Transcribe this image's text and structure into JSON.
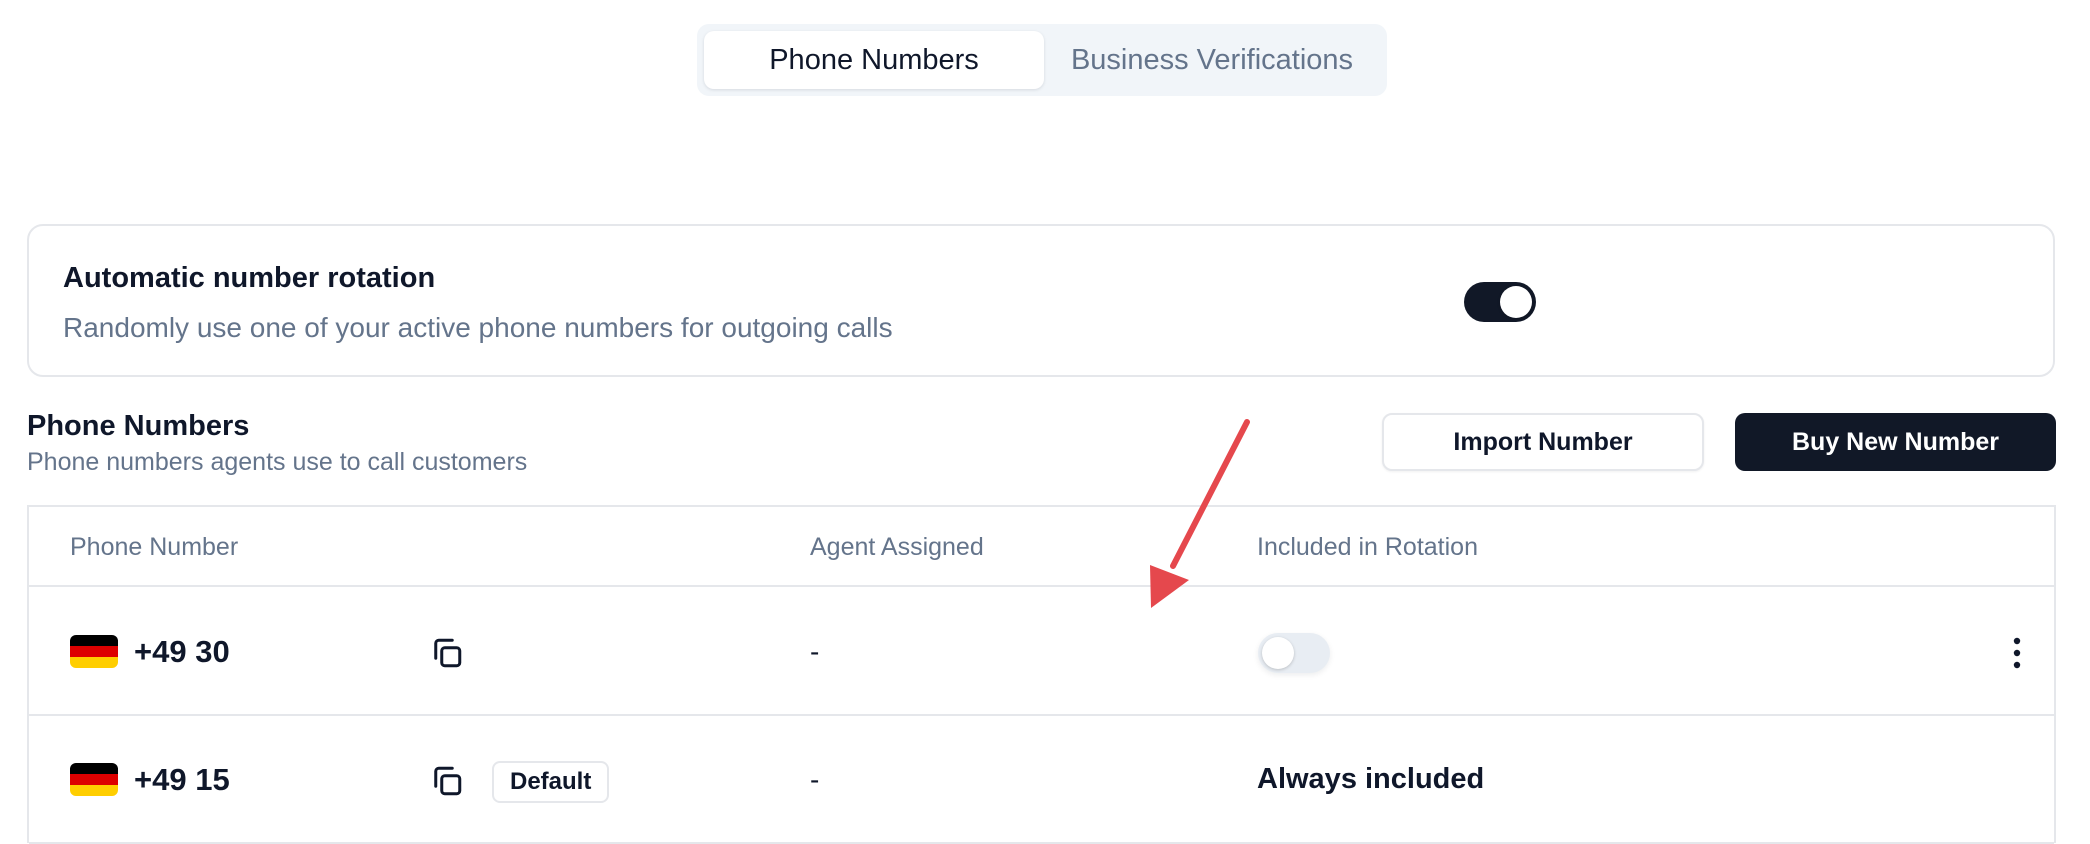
{
  "tabs": [
    {
      "label": "Phone Numbers",
      "active": true
    },
    {
      "label": "Business Verifications",
      "active": false
    }
  ],
  "rotation": {
    "title": "Automatic number rotation",
    "description": "Randomly use one of your active phone numbers for outgoing calls",
    "enabled": true
  },
  "section": {
    "title": "Phone Numbers",
    "subtitle": "Phone numbers agents use to call customers",
    "import_label": "Import Number",
    "buy_label": "Buy New Number"
  },
  "table": {
    "columns": [
      "Phone Number",
      "Agent Assigned",
      "Included in Rotation"
    ],
    "rows": [
      {
        "flag": "germany-flag-icon",
        "number": "+49 30",
        "badge": "",
        "agent": "-",
        "rotation_enabled": false,
        "rotation_text": ""
      },
      {
        "flag": "germany-flag-icon",
        "number": "+49 15",
        "badge": "Default",
        "agent": "-",
        "rotation_enabled": null,
        "rotation_text": "Always included"
      }
    ]
  },
  "colors": {
    "dark": "#111827",
    "muted": "#64748b",
    "border": "#e5e7eb",
    "annotation_arrow": "#e5484d",
    "flag_black": "#000000",
    "flag_red": "#dd0000",
    "flag_gold": "#ffce00"
  }
}
